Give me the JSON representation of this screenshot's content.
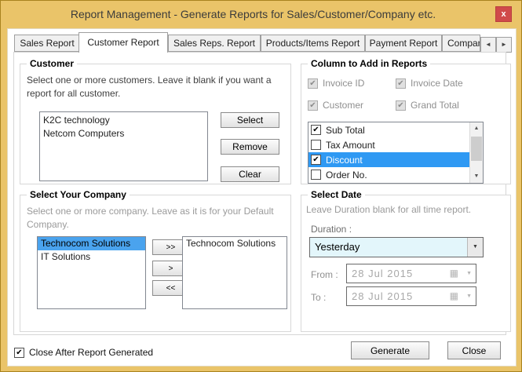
{
  "window": {
    "title": "Report Management - Generate Reports for Sales/Customer/Company etc."
  },
  "icons": {
    "close": "x",
    "check": "✔",
    "dropdown_arrow": "▼",
    "scroll_up": "▲",
    "scroll_down": "▼",
    "tab_prev": "◄",
    "tab_next": "►",
    "calendar": "▦"
  },
  "colors": {
    "titlebar_gold": "#eac469",
    "close_button_red": "#d04a4a",
    "list_selection_blue": "#2f99f3",
    "company_selection_blue": "#4aa3ee",
    "combo_background": "#e3f6fb"
  },
  "tabs": [
    {
      "label": "Sales Report",
      "active": false
    },
    {
      "label": "Customer Report",
      "active": true
    },
    {
      "label": "Sales Reps. Report",
      "active": false
    },
    {
      "label": "Products/Items Report",
      "active": false
    },
    {
      "label": "Payment Report",
      "active": false
    },
    {
      "label": "Company",
      "active": false
    }
  ],
  "customer": {
    "title": "Customer",
    "description": "Select one or more customers. Leave it blank if you want a report for all customer.",
    "items": [
      "K2C technology",
      "Netcom Computers"
    ],
    "select_label": "Select",
    "remove_label": "Remove",
    "clear_label": "Clear"
  },
  "columns": {
    "title": "Column to Add in Reports",
    "fixed": [
      {
        "label": "Invoice ID",
        "checked": true,
        "disabled": true
      },
      {
        "label": "Invoice Date",
        "checked": true,
        "disabled": true
      },
      {
        "label": "Customer",
        "checked": true,
        "disabled": true
      },
      {
        "label": "Grand Total",
        "checked": true,
        "disabled": true
      }
    ],
    "list": [
      {
        "label": "Sub Total",
        "checked": true,
        "selected": false
      },
      {
        "label": "Tax Amount",
        "checked": false,
        "selected": false
      },
      {
        "label": "Discount",
        "checked": true,
        "selected": true
      },
      {
        "label": "Order No.",
        "checked": false,
        "selected": false
      }
    ]
  },
  "company": {
    "title": "Select Your Company",
    "description": "Select one or more company. Leave as it is for your Default Company.",
    "available": [
      {
        "label": "Technocom Solutions",
        "selected": true
      },
      {
        "label": "IT Solutions",
        "selected": false
      }
    ],
    "chosen": [
      "Technocom Solutions"
    ],
    "move_all_right_label": ">>",
    "move_right_label": ">",
    "move_all_left_label": "<<"
  },
  "date": {
    "title": "Select Date",
    "description": "Leave Duration blank for all time report.",
    "duration_label": "Duration :",
    "duration_value": "Yesterday",
    "from_label": "From :",
    "from_value": "28 Jul 2015",
    "to_label": "To :",
    "to_value": "28 Jul 2015"
  },
  "footer": {
    "close_after_label": "Close After Report Generated",
    "close_after_checked": true,
    "generate_label": "Generate",
    "close_label": "Close"
  }
}
